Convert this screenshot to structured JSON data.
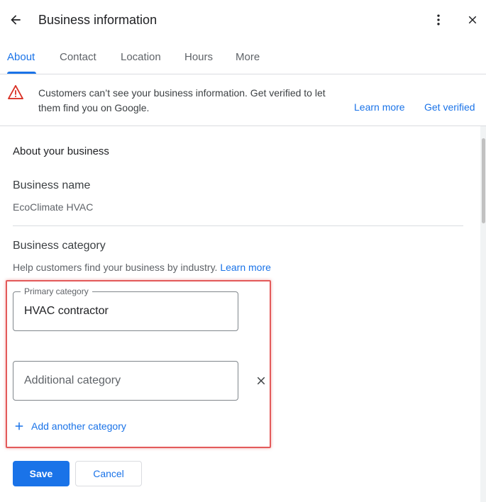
{
  "header": {
    "title": "Business information"
  },
  "tabs": [
    {
      "label": "About",
      "active": true
    },
    {
      "label": "Contact"
    },
    {
      "label": "Location"
    },
    {
      "label": "Hours"
    },
    {
      "label": "More"
    }
  ],
  "banner": {
    "message": "Customers can’t see your business information. Get verified to let them find you on Google.",
    "learn_more": "Learn more",
    "get_verified": "Get verified"
  },
  "about": {
    "section_title": "About your business",
    "business_name_label": "Business name",
    "business_name_value": "EcoClimate HVAC",
    "category_label": "Business category",
    "category_help": "Help customers find your business by industry.",
    "category_help_link": "Learn more",
    "primary_category_label": "Primary category",
    "primary_category_value": "HVAC contractor",
    "additional_category_placeholder": "Additional category",
    "add_another_label": "Add another category"
  },
  "actions": {
    "save_label": "Save",
    "cancel_label": "Cancel"
  },
  "colors": {
    "accent": "#1a73e8",
    "warning": "#d93025",
    "highlight": "#e35a5a"
  }
}
